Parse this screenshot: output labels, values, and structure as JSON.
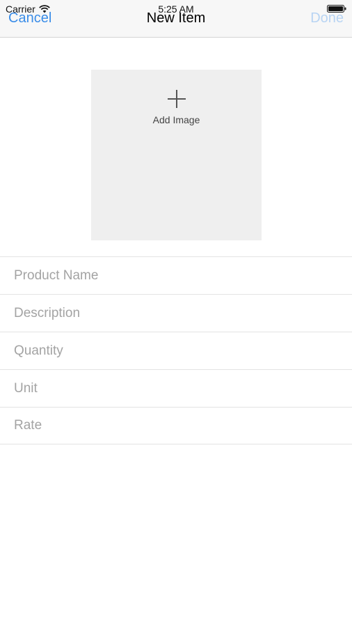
{
  "status_bar": {
    "carrier": "Carrier",
    "time": "5:25 AM",
    "wifi_icon": "wifi-icon",
    "battery_icon": "battery-icon"
  },
  "nav": {
    "cancel_label": "Cancel",
    "title": "New Item",
    "done_label": "Done",
    "accent_color": "#3a8de8",
    "disabled_color": "#b8d4f3"
  },
  "image_picker": {
    "icon": "plus-icon",
    "label": "Add Image"
  },
  "fields": [
    {
      "placeholder": "Product Name",
      "value": ""
    },
    {
      "placeholder": "Description",
      "value": ""
    },
    {
      "placeholder": "Quantity",
      "value": ""
    },
    {
      "placeholder": "Unit",
      "value": ""
    },
    {
      "placeholder": "Rate",
      "value": ""
    }
  ]
}
